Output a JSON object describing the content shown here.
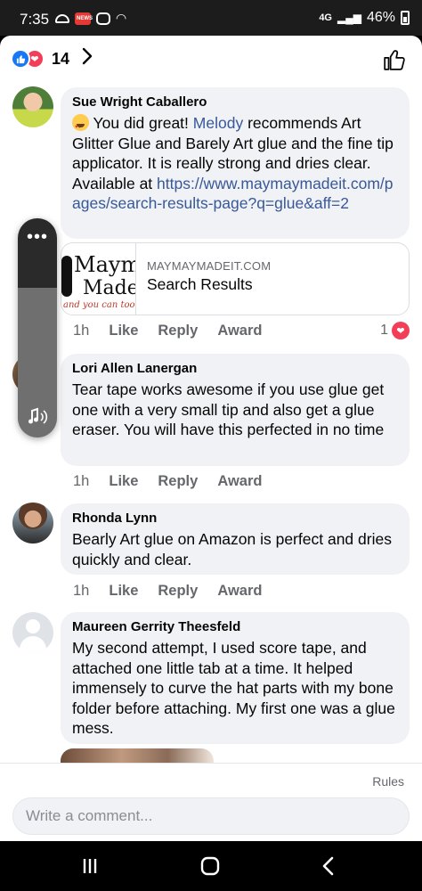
{
  "status_bar": {
    "time": "7:35",
    "network": "4G",
    "battery": "46%"
  },
  "reactions": {
    "count": "14",
    "like_icon": "thumbs-up-icon",
    "love_icon": "heart-icon"
  },
  "comments": [
    {
      "author": "Sue Wright Caballero",
      "text_before_mention": "You did great! ",
      "mention": "Melody",
      "text_after_mention": " recommends Art Glitter Glue and Barely Art glue and the fine tip applicator.  It is really strong and dries clear.  Available at ",
      "link": "https://www.maymaymadeit.com/pages/search-results-page?q=glue&aff=2",
      "preview": {
        "domain": "MAYMAYMADEIT.COM",
        "title": "Search Results",
        "thumb_line1": "Maym",
        "thumb_line2": "Made",
        "thumb_line3": "and you can too"
      },
      "time": "1h",
      "like": "Like",
      "reply": "Reply",
      "award": "Award",
      "reaction_count": "1"
    },
    {
      "author": "Lori Allen Lanergan",
      "text": "Tear tape works awesome if you use glue get one with a very small tip and also get a glue eraser.  You will have this perfected in no time",
      "time": "1h",
      "like": "Like",
      "reply": "Reply",
      "award": "Award"
    },
    {
      "author": "Rhonda Lynn",
      "text": "Bearly Art glue on Amazon is perfect and dries quickly and clear.",
      "time": "1h",
      "like": "Like",
      "reply": "Reply",
      "award": "Award"
    },
    {
      "author": "Maureen Gerrity Theesfeld",
      "text": "My second attempt, I used score tape, and attached one little tab at a time.  It helped immensely to curve the hat parts with my bone folder before attaching.  My first one was a glue mess."
    }
  ],
  "footer": {
    "rules": "Rules",
    "comment_placeholder": "Write a comment..."
  },
  "colors": {
    "link": "#385898",
    "like_blue": "#1877f2",
    "love_red": "#f33e58",
    "bubble_bg": "#f0f2f5"
  }
}
